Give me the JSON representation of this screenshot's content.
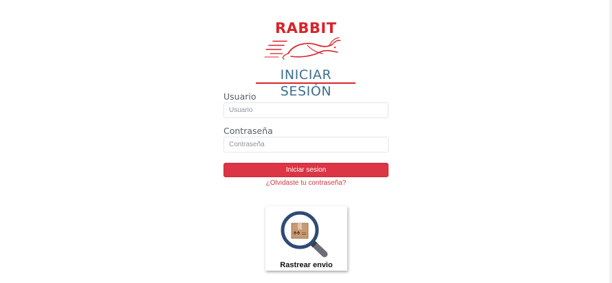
{
  "brand": {
    "logo_text": "RABBIT",
    "color": "#d8232a"
  },
  "login": {
    "title": "INICIAR SESIÓN",
    "username_label": "Usuario",
    "username_placeholder": "Usuario",
    "username_value": "",
    "password_label": "Contraseña",
    "password_placeholder": "Contraseña",
    "password_value": "",
    "submit_label": "Iniciar sesion",
    "forgot_link": "¿Olvidaste tu contraseña?"
  },
  "tracking": {
    "label": "Rastrear envio",
    "icon": "package-search-icon"
  },
  "colors": {
    "accent": "#dc3545",
    "title": "#3d6e8e",
    "link": "#d1383e"
  }
}
